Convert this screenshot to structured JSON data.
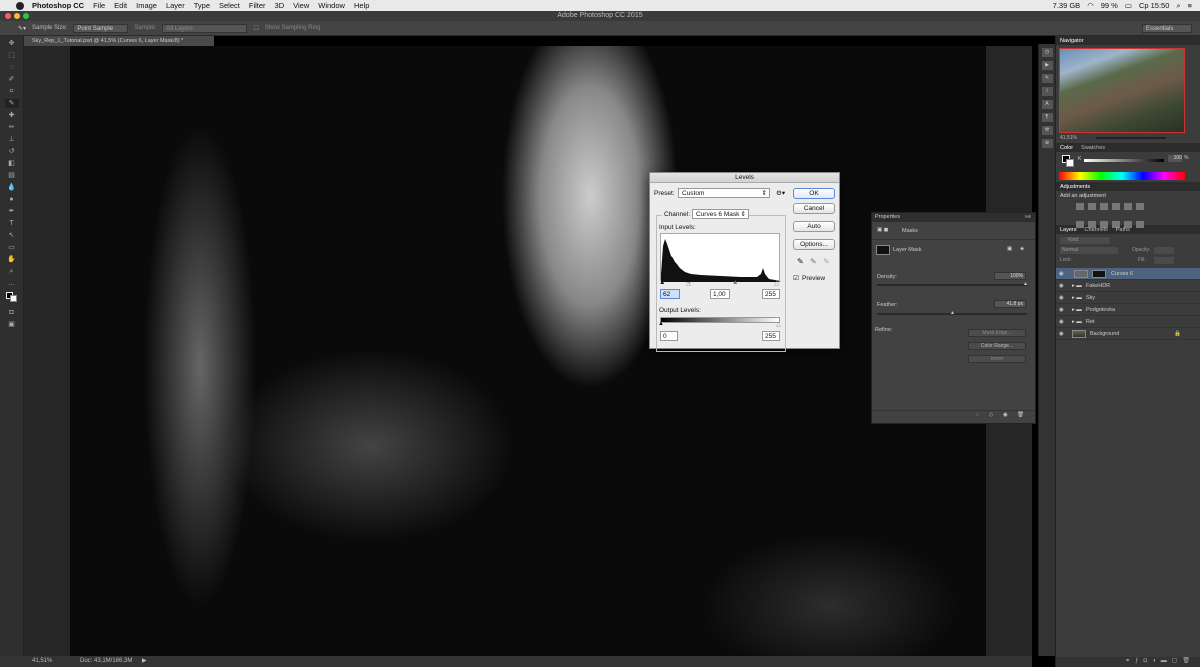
{
  "menubar": {
    "app": "Photoshop CC",
    "items": [
      "File",
      "Edit",
      "Image",
      "Layer",
      "Type",
      "Select",
      "Filter",
      "3D",
      "View",
      "Window",
      "Help"
    ],
    "storage": "7.39 GB",
    "battery": "99 %",
    "clock": "Ср 15:50"
  },
  "window": {
    "title": "Adobe Photoshop CC 2015"
  },
  "options_bar": {
    "sample_size_label": "Sample Size:",
    "sample_size_value": "Point Sample",
    "sample_label": "Sample:",
    "sample_value": "All Layers",
    "show_ring": "Show Sampling Ring",
    "workspace": "Essentials"
  },
  "document": {
    "tab": "Sky_Rep_1_Tutorial.psd @ 41,5% (Curves 6, Layer Mask/8) *",
    "zoom": "41,51%",
    "doc_size": "Doc: 43,1M/186,3M"
  },
  "levels": {
    "title": "Levels",
    "preset_label": "Preset:",
    "preset_value": "Custom",
    "channel_label": "Channel:",
    "channel_value": "Curves 6 Mask",
    "input_label": "Input Levels:",
    "input_black": "62",
    "input_gamma": "1,00",
    "input_white": "255",
    "output_label": "Output Levels:",
    "output_black": "0",
    "output_white": "255",
    "btn_ok": "OK",
    "btn_cancel": "Cancel",
    "btn_auto": "Auto",
    "btn_options": "Options...",
    "preview_label": "Preview"
  },
  "properties": {
    "title": "Properties",
    "tab": "Masks",
    "mask_name": "Layer Mask",
    "density_label": "Density:",
    "density_value": "100%",
    "density_level": 1.0,
    "feather_label": "Feather:",
    "feather_value": "41,8 px",
    "refine_label": "Refine:",
    "mask_edge": "Mask Edge...",
    "color_range": "Color Range...",
    "invert": "Invert"
  },
  "navigator": {
    "title": "Navigator",
    "zoom": "41,51%"
  },
  "color_panel": {
    "tabs": [
      "Color",
      "Swatches"
    ],
    "k_value": "100",
    "k_unit": "%"
  },
  "adjustments": {
    "title": "Adjustments",
    "prompt": "Add an adjustment"
  },
  "layers_panel": {
    "tabs": [
      "Layers",
      "Channels",
      "Paths"
    ],
    "kind": "Kind",
    "blend": "Normal",
    "opacity_label": "Opacity:",
    "lock_label": "Lock:",
    "fill_label": "Fill:",
    "layers": [
      "Curves 6",
      "FakeHDR",
      "Sky",
      "Podgotovka",
      "Ret",
      "Background"
    ],
    "selected": "Curves 6"
  },
  "icons": [
    "apple-icon",
    "eyedropper-icon",
    "gear-icon",
    "search-icon",
    "wifi-icon",
    "battery-icon",
    "lock-icon",
    "eye-icon",
    "folder-icon",
    "link-icon",
    "trash-icon"
  ]
}
